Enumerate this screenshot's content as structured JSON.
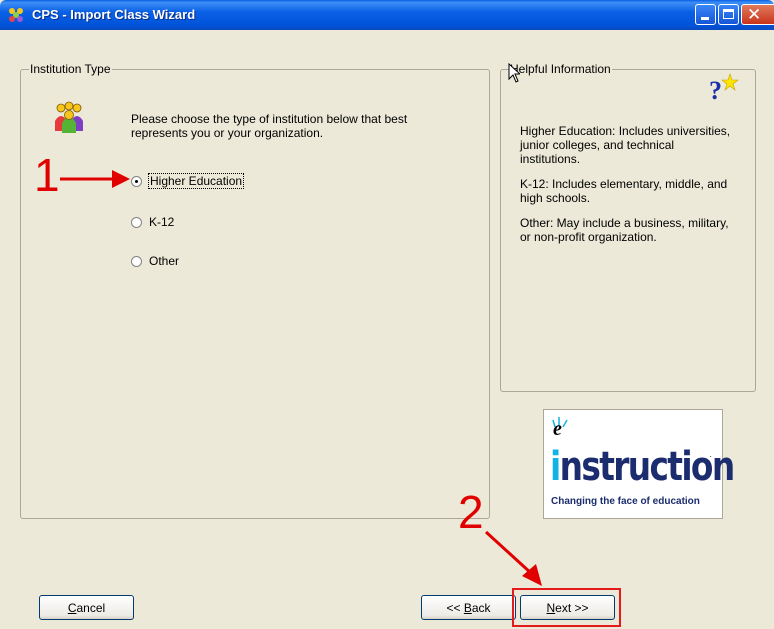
{
  "window": {
    "title": "CPS - Import Class Wizard"
  },
  "institution_group": {
    "legend": "Institution Type",
    "prompt": "Please choose the type of institution below that best represents you or your organization.",
    "options": [
      {
        "label": "Higher Education",
        "checked": true
      },
      {
        "label": "K-12",
        "checked": false
      },
      {
        "label": "Other",
        "checked": false
      }
    ]
  },
  "help_group": {
    "legend": "Helpful Information",
    "paragraphs": [
      "Higher Education:  Includes universities, junior colleges, and technical institutions.",
      "K-12:  Includes elementary, middle, and high schools.",
      "Other:  May include a business, military, or non-profit organization."
    ]
  },
  "logo": {
    "e": "e",
    "word_i": "i",
    "word_rest": "nstruction",
    "trademark": "·",
    "tagline": "Changing the face of education"
  },
  "annotations": {
    "step1": "1",
    "step2": "2",
    "color": "#e10000"
  },
  "buttons": {
    "cancel_prefix": "",
    "cancel_underline": "C",
    "cancel_rest": "ancel",
    "back_prefix": "<< ",
    "back_underline": "B",
    "back_rest": "ack",
    "next_underline": "N",
    "next_rest": "ext >>"
  },
  "icons": {
    "app": "cps-app-icon",
    "people": "people-group-icon",
    "help": "question-mark-icon"
  }
}
